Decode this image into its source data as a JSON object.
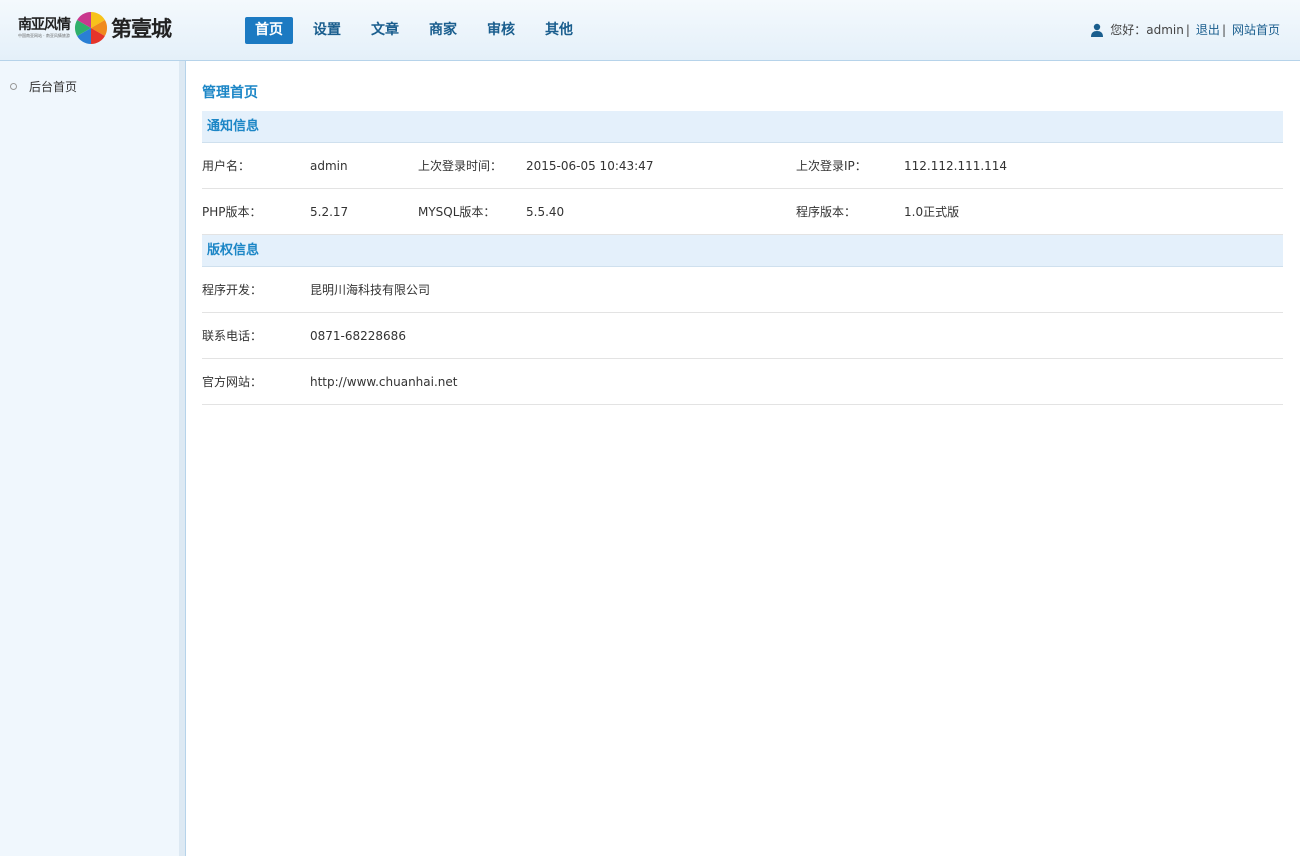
{
  "header": {
    "logo": {
      "brand_small": "南亚风情",
      "tagline": "中国南亚网站 · 南亚风情旅游",
      "brand_big": "第壹城"
    },
    "nav": [
      {
        "label": "首页",
        "active": true
      },
      {
        "label": "设置",
        "active": false
      },
      {
        "label": "文章",
        "active": false
      },
      {
        "label": "商家",
        "active": false
      },
      {
        "label": "审核",
        "active": false
      },
      {
        "label": "其他",
        "active": false
      }
    ],
    "user": {
      "greeting": "您好：admin",
      "separator": "|",
      "logout": "退出",
      "site_home": "网站首页"
    }
  },
  "sidebar": {
    "items": [
      {
        "label": "后台首页"
      }
    ]
  },
  "main": {
    "title": "管理首页",
    "notice": {
      "heading": "通知信息",
      "rows": [
        [
          {
            "label": "用户名：",
            "value": "admin"
          },
          {
            "label": "上次登录时间：",
            "value": "2015-06-05 10:43:47"
          },
          {
            "label": "上次登录IP：",
            "value": "112.112.111.114"
          }
        ],
        [
          {
            "label": "PHP版本：",
            "value": "5.2.17"
          },
          {
            "label": "MYSQL版本：",
            "value": "5.5.40"
          },
          {
            "label": "程序版本：",
            "value": "1.0正式版"
          }
        ]
      ]
    },
    "copyright": {
      "heading": "版权信息",
      "rows": [
        {
          "label": "程序开发：",
          "value": "昆明川海科技有限公司"
        },
        {
          "label": "联系电话：",
          "value": "0871-68228686"
        },
        {
          "label": "官方网站：",
          "value": "http://www.chuanhai.net"
        }
      ]
    }
  },
  "colors": {
    "accent": "#1c7ac2",
    "heading_text": "#1c86c6",
    "section_bg": "#e4f0fb",
    "sidebar_bg": "#f0f7fd"
  }
}
